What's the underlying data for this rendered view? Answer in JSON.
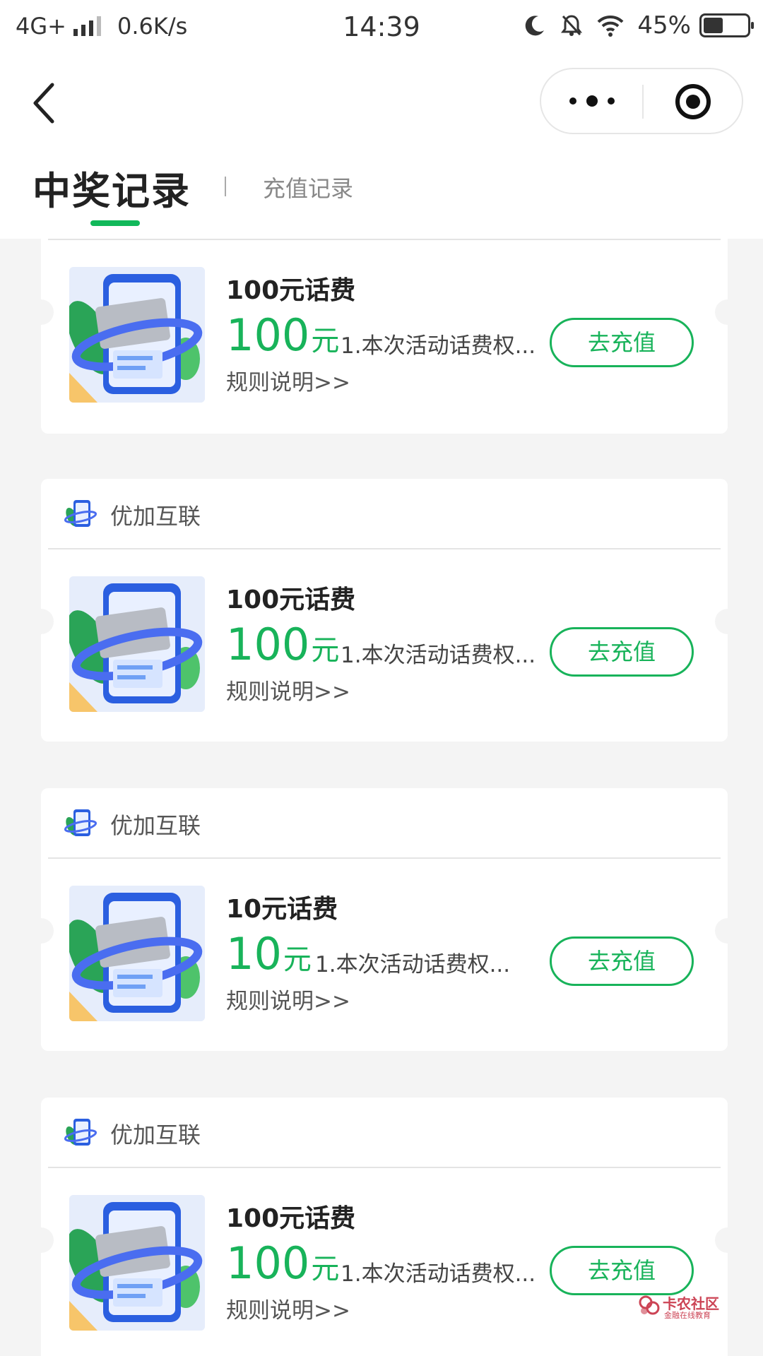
{
  "status_bar": {
    "network": "4G+",
    "speed": "0.6K/s",
    "time": "14:39",
    "battery": "45%",
    "battery_level": 0.45
  },
  "nav": {
    "back_icon": "chevron-left-icon",
    "more_icon": "more-dots-icon",
    "close_icon": "target-close-icon"
  },
  "tabs": {
    "active": "中奖记录",
    "inactive": "充值记录"
  },
  "colors": {
    "accent": "#18b35a",
    "background": "#f4f4f4"
  },
  "cards": [
    {
      "merchant": "",
      "title": "100元话费",
      "amount": "100",
      "unit": "元",
      "desc": "1.本次活动话费权...",
      "rule": "规则说明>>",
      "button": "去充值"
    },
    {
      "merchant": "优加互联",
      "title": "100元话费",
      "amount": "100",
      "unit": "元",
      "desc": "1.本次活动话费权...",
      "rule": "规则说明>>",
      "button": "去充值"
    },
    {
      "merchant": "优加互联",
      "title": "10元话费",
      "amount": "10",
      "unit": "元",
      "desc": "1.本次活动话费权...",
      "rule": "规则说明>>",
      "button": "去充值"
    },
    {
      "merchant": "优加互联",
      "title": "100元话费",
      "amount": "100",
      "unit": "元",
      "desc": "1.本次活动话费权...",
      "rule": "规则说明>>",
      "button": "去充值"
    }
  ],
  "watermark": {
    "title": "卡农社区",
    "subtitle": "金融在线教育"
  }
}
